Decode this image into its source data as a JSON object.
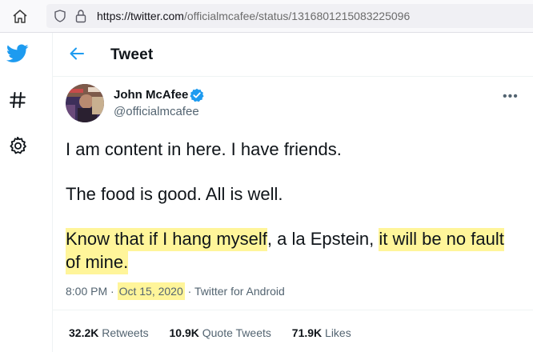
{
  "browser": {
    "url_host": "https://twitter.com",
    "url_path": "/officialmcafee/status/1316801215083225096"
  },
  "header": {
    "title": "Tweet"
  },
  "tweet": {
    "author_name": "John McAfee",
    "author_handle": "@officialmcafee",
    "lines": [
      "I am content in here. I have friends.",
      "The food is good. All is well."
    ],
    "highlight_a": "Know that if I hang myself",
    "plain_mid": ", a la Epstein, ",
    "highlight_b": "it will be no fault of mine.",
    "time": "8:00 PM",
    "dot1": " · ",
    "date": "Oct 15, 2020",
    "dot2": " · ",
    "source": "Twitter for Android",
    "more_label": "•••"
  },
  "stats": {
    "retweets_count": "32.2K",
    "retweets_label": "Retweets",
    "quotes_count": "10.9K",
    "quotes_label": "Quote Tweets",
    "likes_count": "71.9K",
    "likes_label": "Likes"
  },
  "icons": {
    "home": "home-icon",
    "shield": "shield-icon",
    "lock": "lock-icon",
    "twitter": "twitter-bird-icon",
    "explore": "hashtag-icon",
    "settings": "gear-icon",
    "back": "arrow-left-icon",
    "verified": "verified-badge-icon"
  },
  "colors": {
    "accent": "#1d9bf0",
    "highlight": "#fff59a",
    "text": "#0f1419",
    "muted": "#536471"
  }
}
